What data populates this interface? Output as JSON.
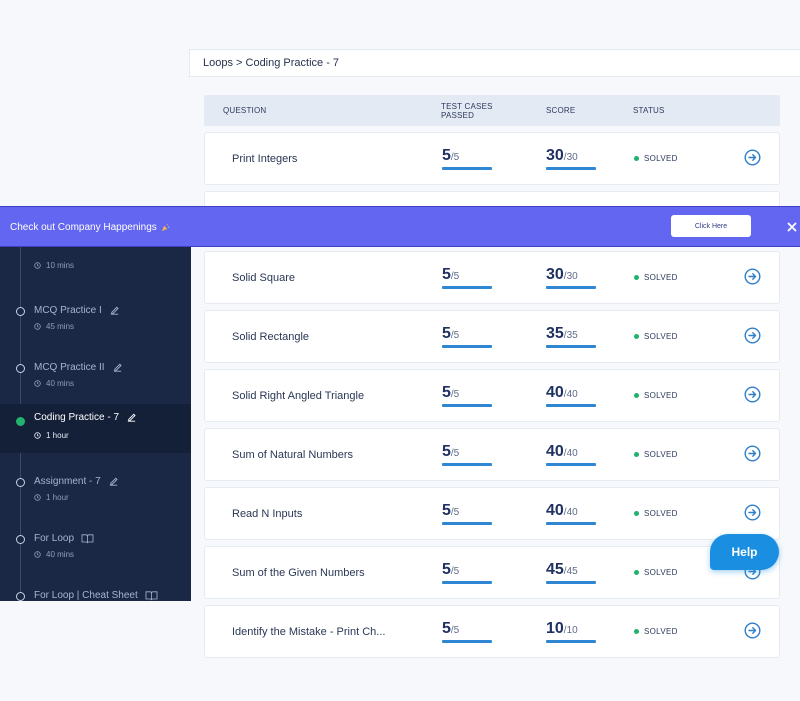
{
  "breadcrumb": {
    "text": "Loops > Coding Practice - 7"
  },
  "table": {
    "headers": {
      "question": "QUESTION",
      "test_cases_1": "TEST CASES",
      "test_cases_2": "PASSED",
      "score": "SCORE",
      "status": "STATUS"
    },
    "rows": [
      {
        "question": "Print Integers",
        "passed": "5",
        "total": "/5",
        "score": "30",
        "max": "/30",
        "status": "SOLVED"
      },
      {
        "question": "",
        "passed": "",
        "total": "",
        "score": "",
        "max": "",
        "status": ""
      },
      {
        "question": "Solid Square",
        "passed": "5",
        "total": "/5",
        "score": "30",
        "max": "/30",
        "status": "SOLVED"
      },
      {
        "question": "Solid Rectangle",
        "passed": "5",
        "total": "/5",
        "score": "35",
        "max": "/35",
        "status": "SOLVED"
      },
      {
        "question": "Solid Right Angled Triangle",
        "passed": "5",
        "total": "/5",
        "score": "40",
        "max": "/40",
        "status": "SOLVED"
      },
      {
        "question": "Sum of Natural Numbers",
        "passed": "5",
        "total": "/5",
        "score": "40",
        "max": "/40",
        "status": "SOLVED"
      },
      {
        "question": "Read N Inputs",
        "passed": "5",
        "total": "/5",
        "score": "40",
        "max": "/40",
        "status": "SOLVED"
      },
      {
        "question": "Sum of the Given Numbers",
        "passed": "5",
        "total": "/5",
        "score": "45",
        "max": "/45",
        "status": "SOLVED"
      },
      {
        "question": "Identify the Mistake - Print Ch...",
        "passed": "5",
        "total": "/5",
        "score": "10",
        "max": "/10",
        "status": "SOLVED"
      }
    ]
  },
  "banner": {
    "text": "Check out Company Happenings",
    "button": "Click Here",
    "close_icon": "close-icon"
  },
  "sidebar": {
    "top_duration": "10 mins",
    "items": [
      {
        "title": "MCQ Practice I",
        "duration": "45 mins",
        "icon": "edit-icon"
      },
      {
        "title": "MCQ Practice II",
        "duration": "40 mins",
        "icon": "edit-icon"
      },
      {
        "title": "Coding Practice - 7",
        "duration": "1 hour",
        "icon": "edit-icon",
        "active": true
      },
      {
        "title": "Assignment - 7",
        "duration": "1 hour",
        "icon": "edit-icon"
      },
      {
        "title": "For Loop",
        "duration": "40 mins",
        "icon": "book-icon"
      },
      {
        "title": "For Loop | Cheat Sheet",
        "duration": "",
        "icon": "book-icon"
      }
    ]
  },
  "help": {
    "label": "Help"
  },
  "colors": {
    "banner": "#6366f1",
    "sidebar": "#1b2845",
    "solved_dot": "#20b16b",
    "accent": "#2f86d2",
    "help": "#1a8fe1"
  }
}
